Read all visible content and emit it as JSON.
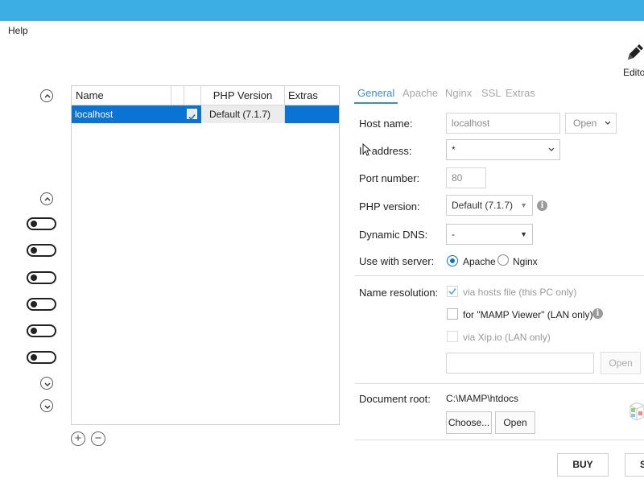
{
  "menu": {
    "help": "Help"
  },
  "toolbar": {
    "editor_label": "Edito",
    "editor_icon": "pencil-icon"
  },
  "host_list": {
    "columns": [
      "Name",
      "PHP Version",
      "Extras"
    ],
    "rows": [
      {
        "name": "localhost",
        "checked": true,
        "php": "Default (7.1.7)",
        "extras": ""
      }
    ]
  },
  "tabs": [
    "General",
    "Apache",
    "Nginx",
    "SSL",
    "Extras"
  ],
  "form": {
    "host_name_label": "Host name:",
    "host_name_value": "localhost",
    "host_open": "Open",
    "ip_label": "IP address:",
    "ip_value": "*",
    "port_label": "Port number:",
    "port_value": "80",
    "php_label": "PHP version:",
    "php_value": "Default (7.1.7)",
    "dns_label": "Dynamic DNS:",
    "dns_value": "-",
    "server_label": "Use with server:",
    "server_apache": "Apache",
    "server_nginx": "Nginx",
    "name_res_label": "Name resolution:",
    "via_hosts": "via hosts file (this PC only)",
    "mamp_viewer": "for \"MAMP Viewer\" (LAN only)",
    "via_xip": "via Xip.io (LAN only)",
    "xip_open": "Open",
    "doc_root_label": "Document root:",
    "doc_root_value": "C:\\MAMP\\htdocs",
    "choose": "Choose...",
    "open": "Open"
  },
  "bottom": {
    "buy": "BUY",
    "second": "S"
  },
  "colors": {
    "accent": "#3daee3",
    "selection": "#0a74d4",
    "tab_active": "#3a8fd0"
  }
}
